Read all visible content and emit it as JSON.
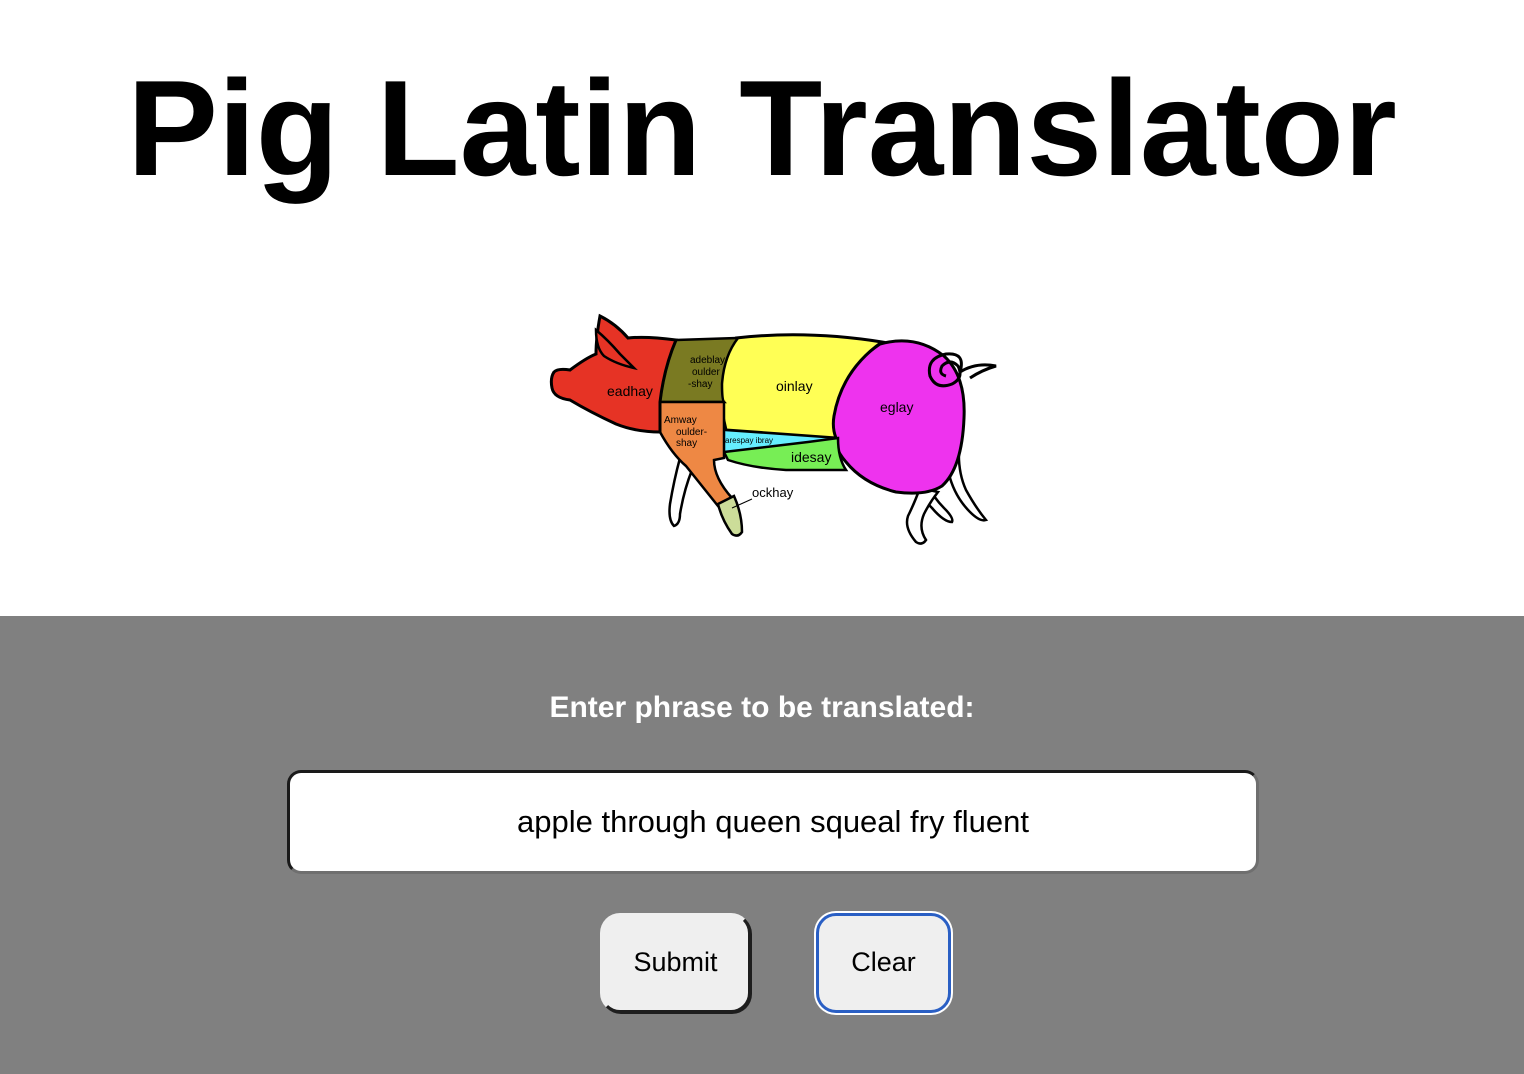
{
  "page": {
    "title": "Pig Latin Translator"
  },
  "pig_diagram": {
    "labels": {
      "head": "eadhay",
      "blade_shoulder_1": "adeblay",
      "blade_shoulder_2": "oulder",
      "blade_shoulder_3": "-shay",
      "loin": "oinlay",
      "leg": "eglay",
      "arm_shoulder_1": "Amway",
      "arm_shoulder_2": "oulder-",
      "arm_shoulder_3": "shay",
      "spare_ribs": "arespay ibray",
      "side": "idesay",
      "hock": "ockhay"
    },
    "colors": {
      "head": "#e63325",
      "blade_shoulder": "#7a7a22",
      "loin": "#ffff55",
      "leg": "#ee33ee",
      "arm_shoulder": "#ee8844",
      "spare_ribs": "#66eeff",
      "side": "#77ee55",
      "hock": "#ccdd99"
    }
  },
  "form": {
    "prompt_label": "Enter phrase to be translated:",
    "input_value": "apple through queen squeal fry fluent",
    "submit_label": "Submit",
    "clear_label": "Clear"
  },
  "colors": {
    "form_background": "#808080",
    "clear_focus_ring": "#2a5fc4"
  }
}
